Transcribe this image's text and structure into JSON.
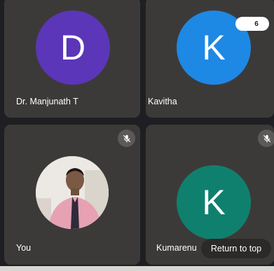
{
  "participants": [
    {
      "name": "Dr. Manjunath T",
      "initial": "D",
      "avatar_color": "#5b36b8",
      "muted": false
    },
    {
      "name": "Kavitha",
      "initial": "K",
      "avatar_color": "#1e88e5",
      "muted": false
    },
    {
      "name": "You",
      "initial": "",
      "avatar_color": "#e9e6e1",
      "muted": true
    },
    {
      "name": "Kumarenu",
      "initial": "K",
      "avatar_color": "#10806e",
      "muted": true
    }
  ],
  "overflow_badge": {
    "count": "6"
  },
  "return_to_top": {
    "label": "Return to top"
  },
  "colors": {
    "tile_bg": "#3c3a38",
    "mic_bg": "#5c5a58",
    "page_bg": "#1e1f22"
  }
}
